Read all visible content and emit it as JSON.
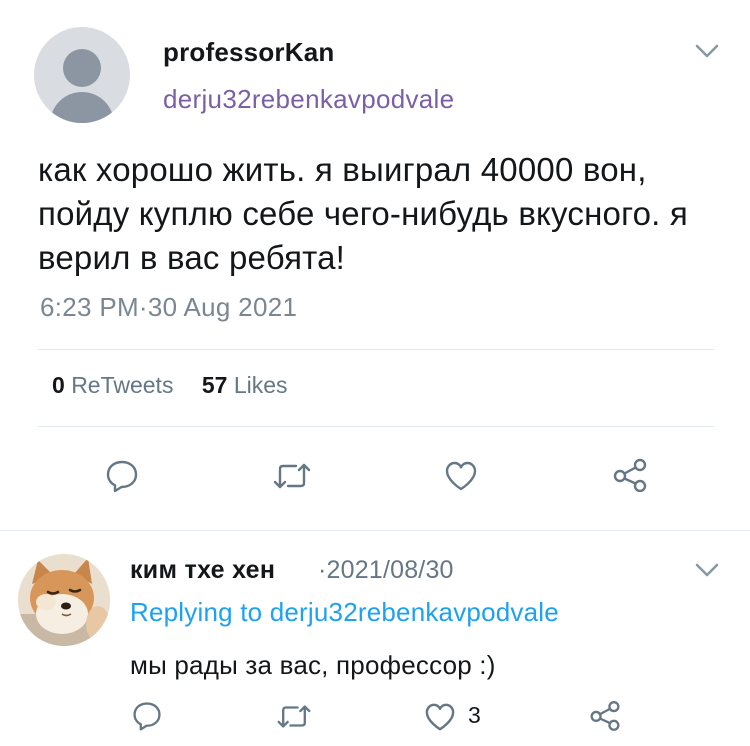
{
  "main_tweet": {
    "display_name": "professorKan",
    "handle": "derju32rebenkavpodvale",
    "text": "как хорошо жить. я выиграл 40000 вон, пойду куплю себе чего-нибудь вкусного. я верил в вас ребята!",
    "timestamp": "6:23 PM·30 Aug 2021",
    "retweets_count": "0",
    "retweets_label": "ReTweets",
    "likes_count": "57",
    "likes_label": "Likes",
    "icons": {
      "avatar": "default-avatar",
      "menu": "chevron-down-icon",
      "reply": "reply-icon",
      "retweet": "retweet-icon",
      "like": "heart-icon",
      "share": "share-icon"
    }
  },
  "reply_tweet": {
    "display_name": "ким тхе хен",
    "date": "·2021/08/30",
    "replying_prefix": "Replying to",
    "replying_to": "derju32rebenkavpodvale",
    "text": "мы рады за вас, профессор :)",
    "like_count": "3",
    "icons": {
      "avatar": "dog-avatar",
      "menu": "chevron-down-icon"
    }
  },
  "colors": {
    "text": "#14171a",
    "handle": "#7b5fa6",
    "muted": "#657786",
    "timestamp": "#7a8793",
    "link": "#1da1f2",
    "divider": "#e1e8ed",
    "icon": "#657786"
  }
}
